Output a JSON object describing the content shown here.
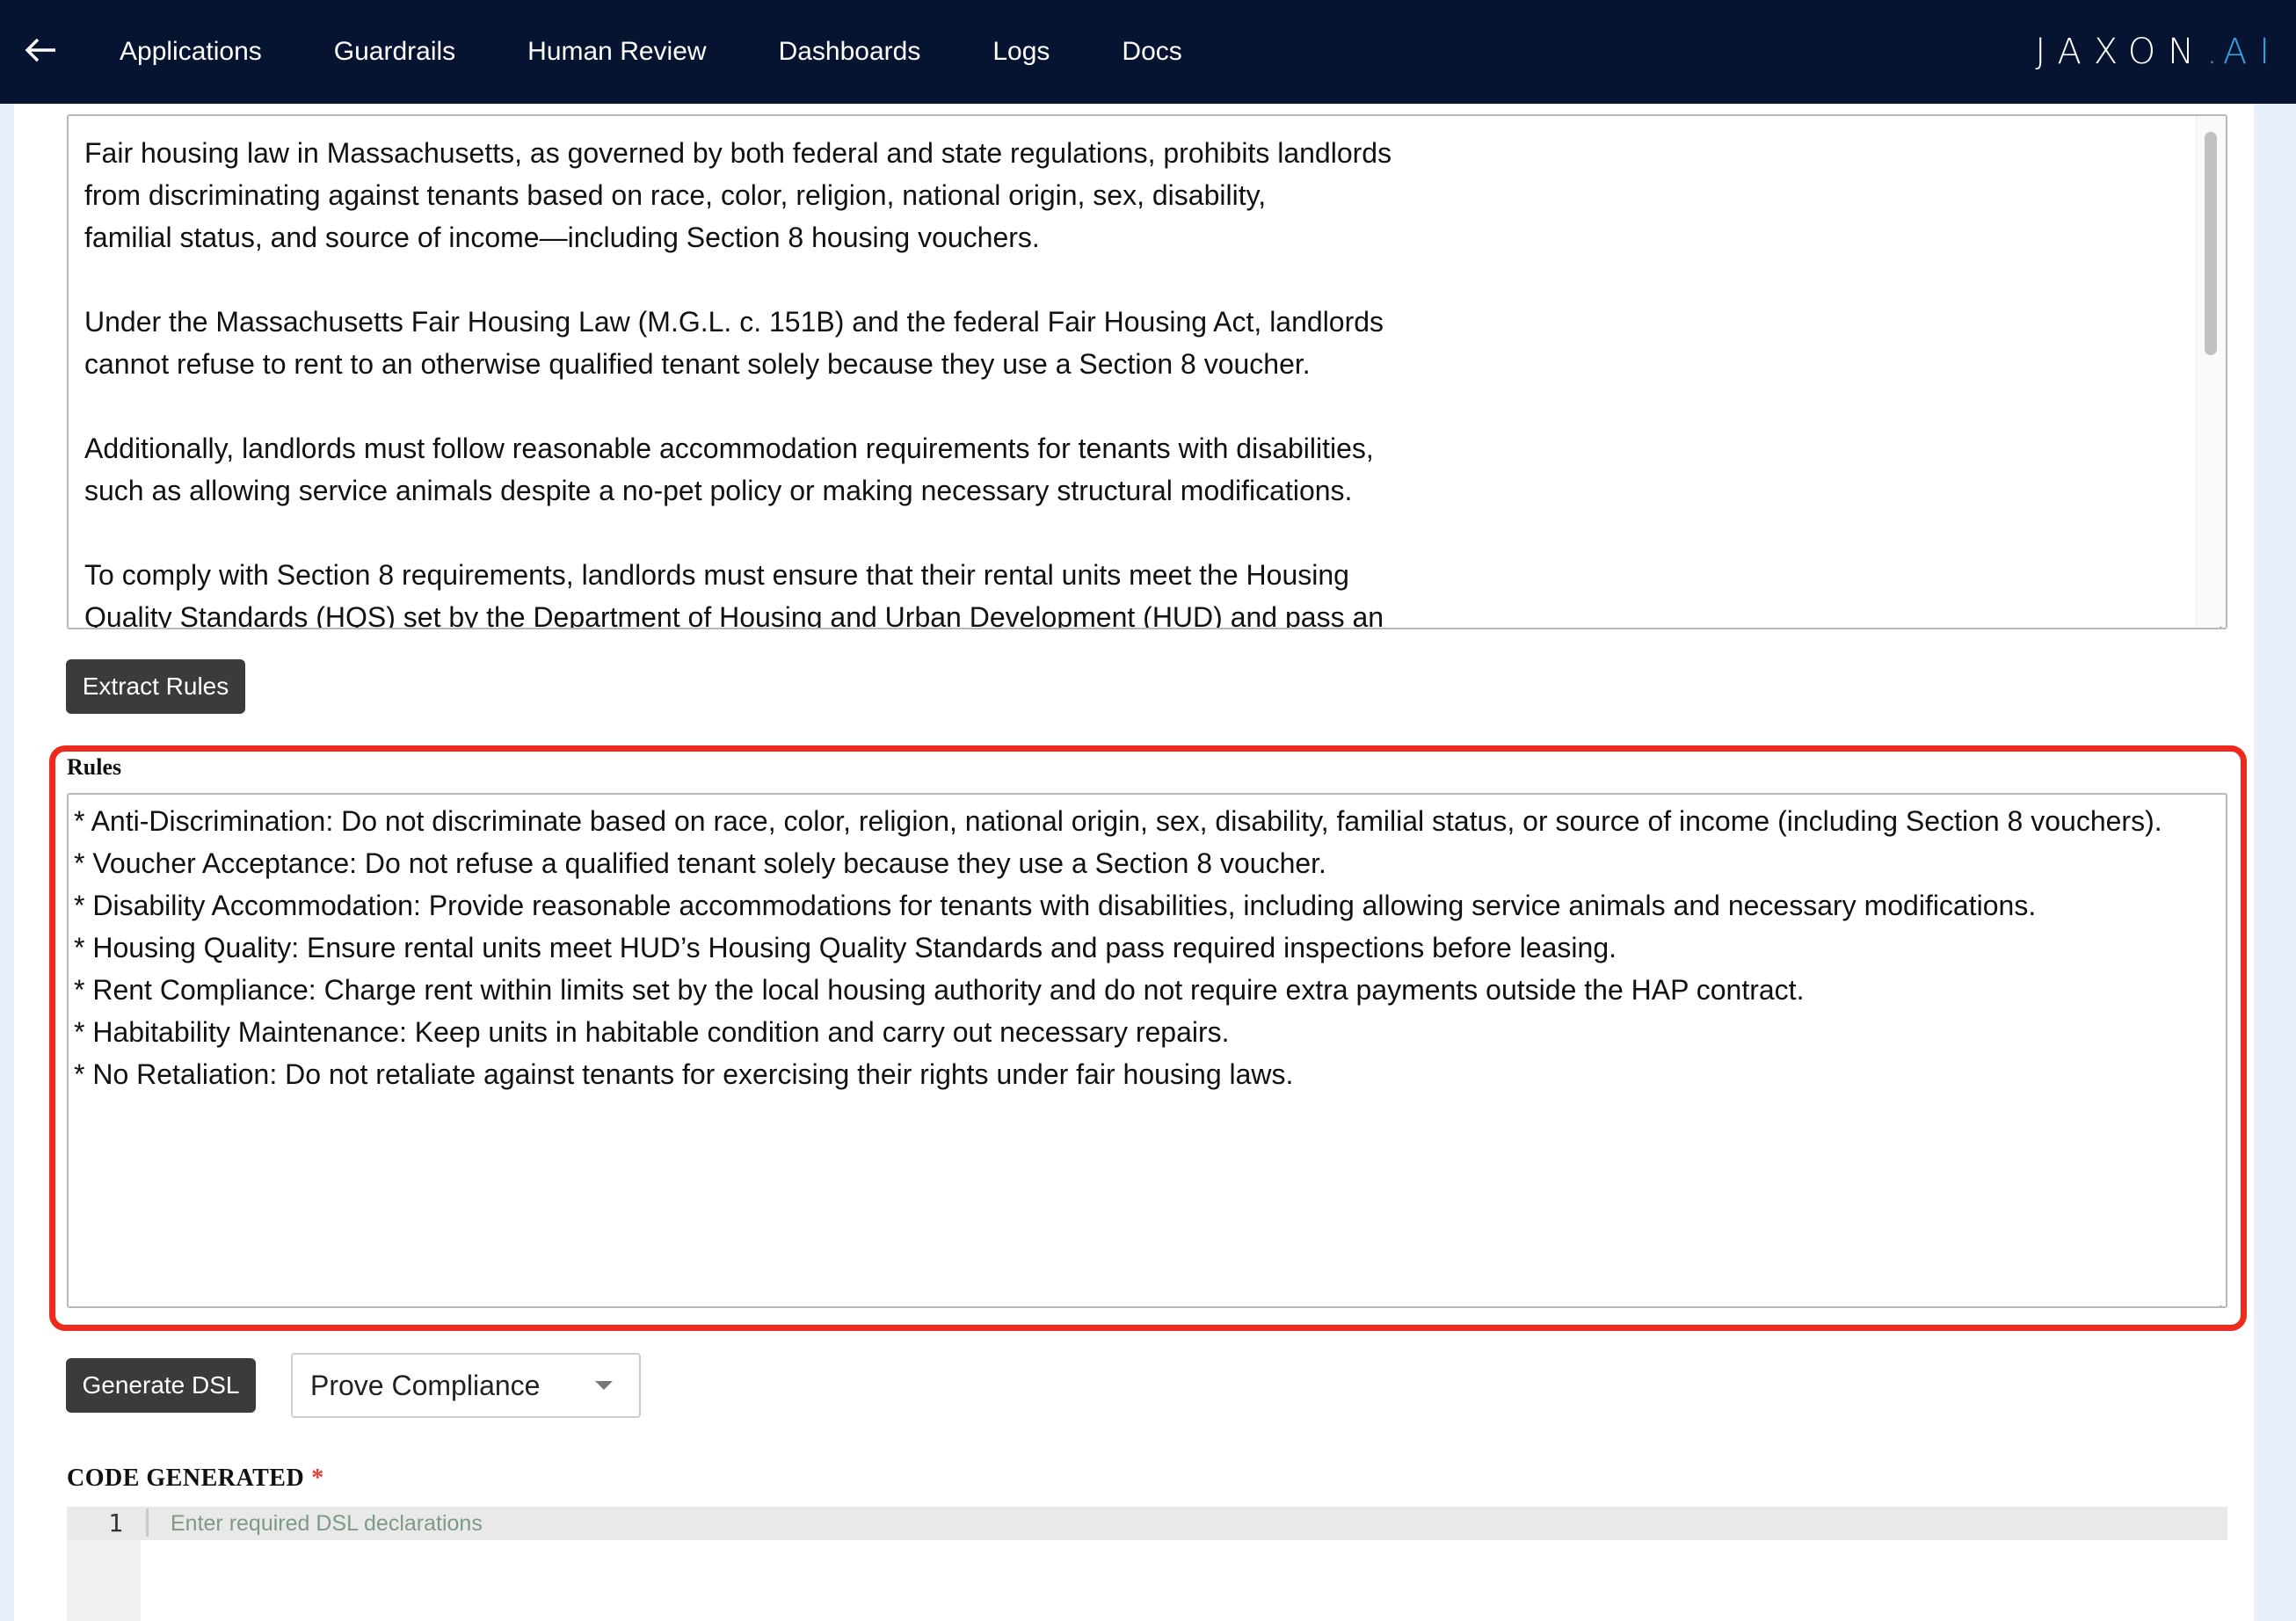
{
  "nav": {
    "back_icon": "arrow-left-icon",
    "links": [
      "Applications",
      "Guardrails",
      "Human Review",
      "Dashboards",
      "Logs",
      "Docs"
    ],
    "brand_main": "JAXON",
    "brand_dot": ".",
    "brand_suffix": "AI",
    "bg_color": "#061431",
    "brand_accent": "#2fa4e7"
  },
  "source_text": {
    "lines": [
      "Fair housing law in Massachusetts, as governed by both federal and state regulations, prohibits landlords",
      "from discriminating against tenants based on race, color, religion, national origin, sex, disability,",
      "familial status, and source of income—including Section 8 housing vouchers.",
      "",
      "Under the Massachusetts Fair Housing Law (M.G.L. c. 151B) and the federal Fair Housing Act, landlords",
      "cannot refuse to rent to an otherwise qualified tenant solely because they use a Section 8 voucher.",
      "",
      "Additionally, landlords must follow reasonable accommodation requirements for tenants with disabilities,",
      "such as allowing service animals despite a no-pet policy or making necessary structural modifications.",
      "",
      "To comply with Section 8 requirements, landlords must ensure that their rental units meet the Housing",
      "Quality Standards (HQS) set by the Department of Housing and Urban Development (HUD) and pass an"
    ]
  },
  "extract_button": "Extract Rules",
  "rules": {
    "label": "Rules",
    "lines": [
      "* Anti-Discrimination: Do not discriminate based on race, color, religion, national origin, sex, disability, familial status, or source of income (including Section 8 vouchers).",
      "* Voucher Acceptance: Do not refuse a qualified tenant solely because they use a Section 8 voucher.",
      "* Disability Accommodation: Provide reasonable accommodations for tenants with disabilities, including allowing service animals and necessary modifications.",
      "* Housing Quality: Ensure rental units meet HUD’s Housing Quality Standards and pass required inspections before leasing.",
      "* Rent Compliance: Charge rent within limits set by the local housing authority and do not require extra payments outside the HAP contract.",
      "* Habitability Maintenance: Keep units in habitable condition and carry out necessary repairs.",
      "* No Retaliation: Do not retaliate against tenants for exercising their rights under fair housing laws."
    ],
    "highlight_color": "#ee2a1c"
  },
  "generate_button": "Generate DSL",
  "mode_select": {
    "selected": "Prove Compliance",
    "icon": "caret-down-icon"
  },
  "code": {
    "label": "CODE GENERATED",
    "required_mark": "*",
    "line_number": "1",
    "placeholder": "Enter required DSL declarations"
  }
}
